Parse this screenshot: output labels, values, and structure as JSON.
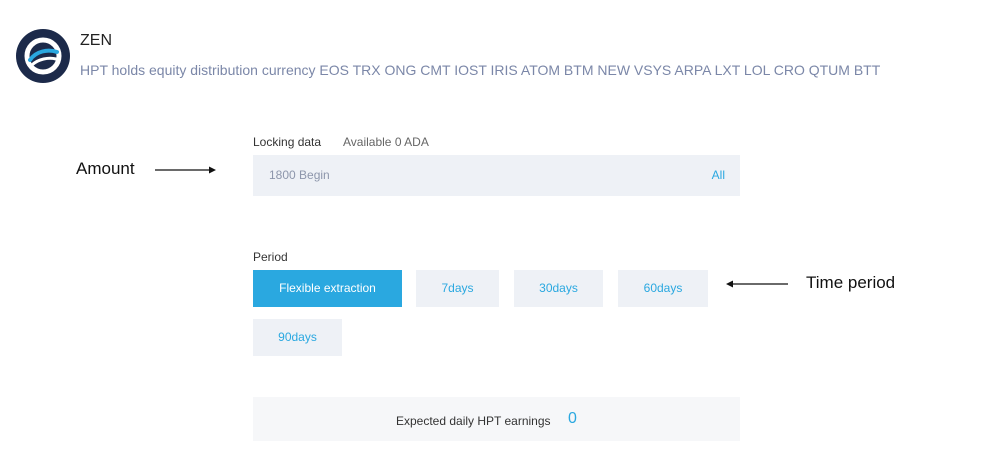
{
  "coin": {
    "title": "ZEN",
    "description": "HPT holds equity distribution currency EOS TRX ONG CMT IOST IRIS ATOM BTM NEW VSYS ARPA LXT LOL CRO QTUM BTT",
    "logo_icon": "zen-logo-icon"
  },
  "annotations": {
    "amount": "Amount",
    "time_period": "Time period"
  },
  "locking": {
    "label": "Locking data",
    "available": "Available 0 ADA",
    "amount_value": "1800 Begin",
    "all_label": "All"
  },
  "period": {
    "label": "Period",
    "options": [
      {
        "label": "Flexible extraction",
        "selected": true
      },
      {
        "label": "7days",
        "selected": false
      },
      {
        "label": "30days",
        "selected": false
      },
      {
        "label": "60days",
        "selected": false
      },
      {
        "label": "90days",
        "selected": false
      }
    ]
  },
  "earnings": {
    "label": "Expected daily HPT earnings",
    "value": "0"
  },
  "colors": {
    "accent": "#2aa8e0",
    "field_bg": "#eef1f6",
    "logo_dark": "#1c2a4a"
  }
}
